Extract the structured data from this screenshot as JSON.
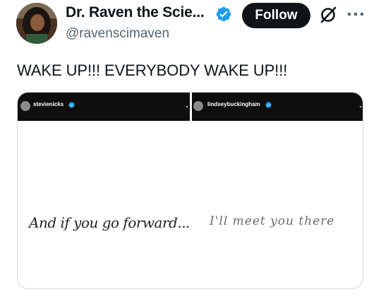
{
  "author": {
    "display_name": "Dr. Raven the Scie...",
    "handle": "@ravenscimaven",
    "avatar_icon": "profile-photo",
    "verified_color": "#1d9bf0"
  },
  "actions": {
    "follow_label": "Follow",
    "grok_icon": "grok-icon",
    "more_icon": "more-icon"
  },
  "tweet": {
    "text": "WAKE UP!!! EVERYBODY WAKE UP!!!"
  },
  "media": {
    "left_story": {
      "username": "stevienicks",
      "handwriting": "And if you go forward..."
    },
    "right_story": {
      "username": "lindseybuckingham",
      "handwriting": "I'll meet you there"
    }
  }
}
